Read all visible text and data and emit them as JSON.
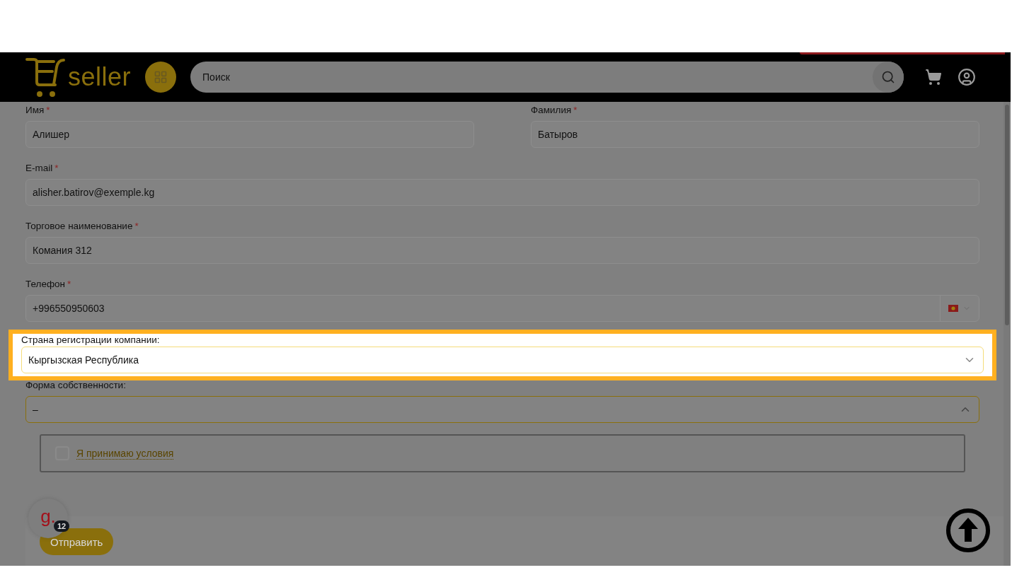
{
  "header": {
    "logo_text": "seller",
    "search": {
      "placeholder": "Поиск"
    }
  },
  "form": {
    "rows": [
      {
        "fields": [
          {
            "kind": "text",
            "label": "Имя",
            "asterisk": "*",
            "value": "Алишер"
          },
          {
            "kind": "text",
            "label": "Фамилия",
            "asterisk": "*",
            "value": "Батыров"
          }
        ]
      },
      {
        "fields": [
          {
            "kind": "text",
            "label": "E-mail",
            "asterisk": "*",
            "value": "alisher.batirov@exemple.kg"
          }
        ]
      },
      {
        "fields": [
          {
            "kind": "text",
            "label": "Торговое наименование",
            "asterisk": "*",
            "value": "Комания 312"
          }
        ]
      },
      {
        "fields": [
          {
            "kind": "phone",
            "label": "Телефон",
            "asterisk": "*",
            "value": "+996550950603"
          }
        ]
      },
      {
        "fields": [
          {
            "kind": "select",
            "label": "Страна регистрации компании:",
            "value": "Кыргызская Республика",
            "expanded": false,
            "highlighted": true
          }
        ]
      },
      {
        "fields": [
          {
            "kind": "select",
            "label": "Форма собственности:",
            "value": "–",
            "expanded": true,
            "highlighted": false
          }
        ]
      }
    ],
    "terms": {
      "label": "Я принимаю условия",
      "checked": false
    },
    "submit": "Отправить"
  },
  "widget": {
    "letter": "g.",
    "count": "12"
  }
}
